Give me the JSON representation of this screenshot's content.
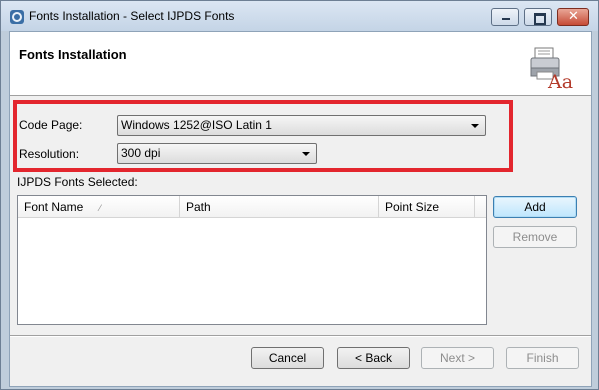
{
  "window": {
    "title": "Fonts Installation - Select IJPDS Fonts",
    "icon": "gear-icon",
    "controls": [
      "minimize-icon",
      "maximize-icon",
      "close-icon"
    ]
  },
  "header": {
    "title": "Fonts Installation",
    "icon": "fonts-printer-icon",
    "icon_text": "Aa"
  },
  "form": {
    "code_page_label": "Code Page:",
    "code_page_value": "Windows 1252@ISO Latin 1",
    "resolution_label": "Resolution:",
    "resolution_value": "300 dpi",
    "highlight_color": "#e3262e"
  },
  "fonts_list": {
    "label": "IJPDS Fonts Selected:",
    "columns": [
      "Font Name",
      "Path",
      "Point Size"
    ],
    "rows": []
  },
  "side_buttons": {
    "add": "Add",
    "remove": "Remove"
  },
  "footer": {
    "cancel": "Cancel",
    "back": "< Back",
    "next": "Next >",
    "finish": "Finish"
  }
}
